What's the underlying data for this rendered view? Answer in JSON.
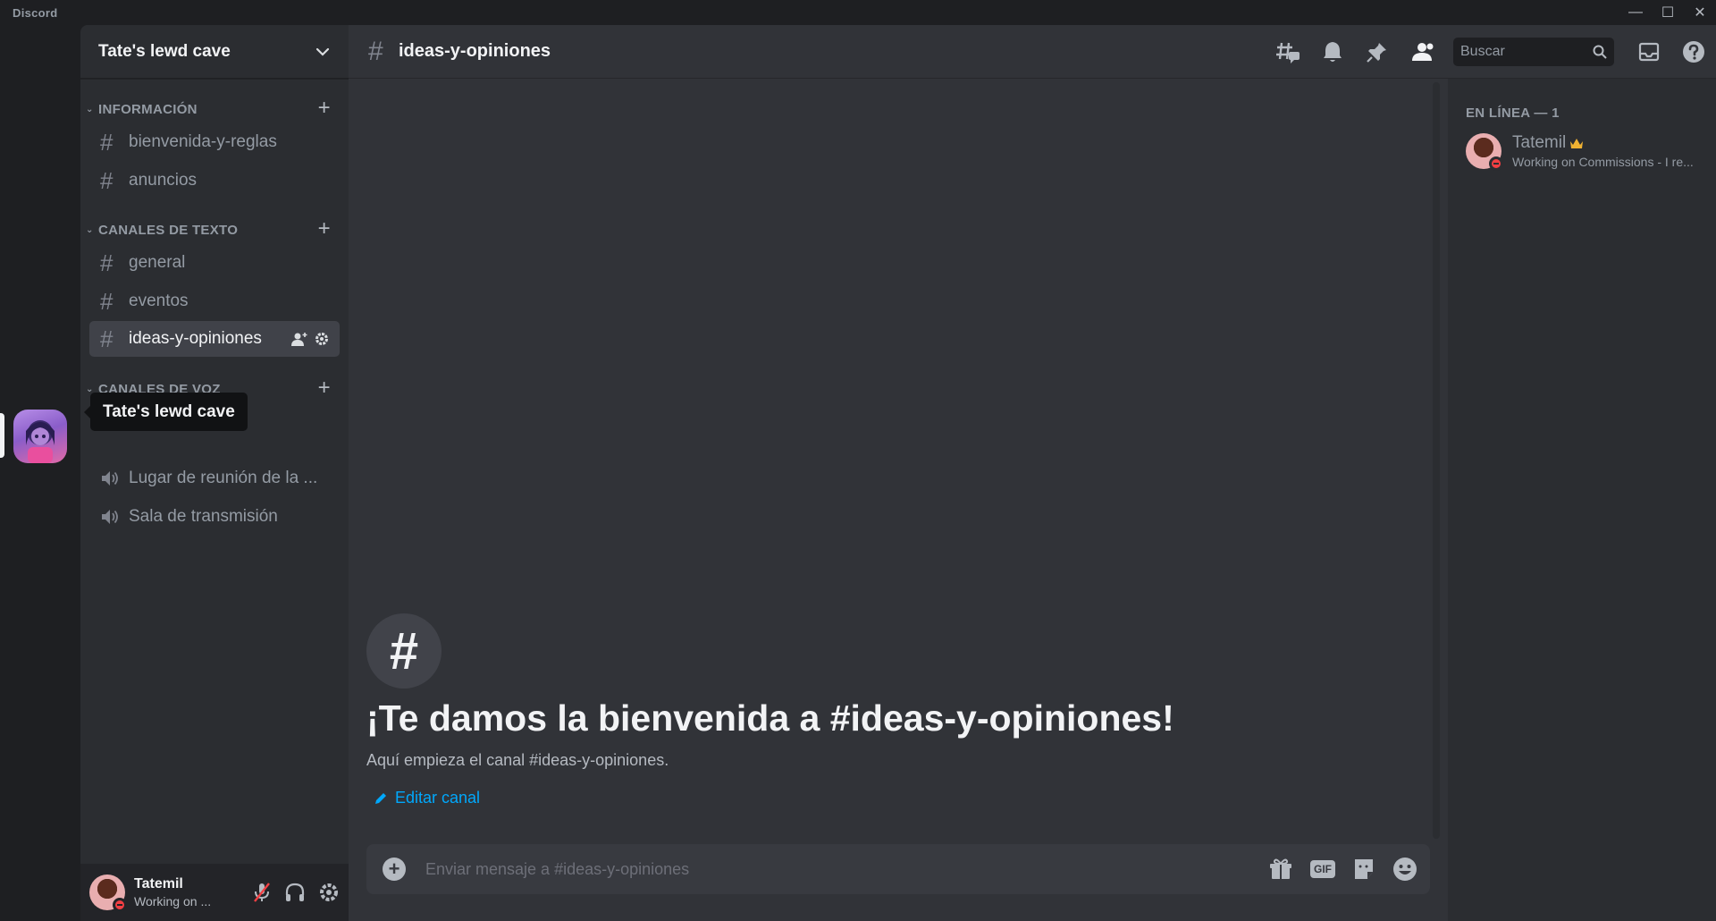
{
  "app": {
    "title": "Discord"
  },
  "server": {
    "name": "Tate's lewd cave",
    "tooltip": "Tate's lewd cave"
  },
  "categories": [
    {
      "name": "INFORMACIÓN"
    },
    {
      "name": "CANALES DE TEXTO"
    },
    {
      "name": "CANALES DE VOZ"
    }
  ],
  "channels": {
    "info": [
      "bienvenida-y-reglas",
      "anuncios"
    ],
    "text": [
      "general",
      "eventos",
      "ideas-y-opiniones"
    ],
    "voice": [
      "Lugar de reunión de la ...",
      "Sala de transmisión"
    ]
  },
  "current_channel": {
    "name": "ideas-y-opiniones"
  },
  "search": {
    "placeholder": "Buscar"
  },
  "welcome": {
    "title": "¡Te damos la bienvenida a #ideas-y-opiniones!",
    "subtitle": "Aquí empieza el canal #ideas-y-opiniones.",
    "edit_label": "Editar canal"
  },
  "composer": {
    "placeholder": "Enviar mensaje a #ideas-y-opiniones",
    "gif_label": "GIF"
  },
  "user": {
    "name": "Tatemil",
    "status": "Working on ..."
  },
  "members": {
    "category": "EN LÍNEA — 1",
    "list": [
      {
        "name": "Tatemil",
        "status": "Working on Commissions - I re..."
      }
    ]
  },
  "colors": {
    "accent_link": "#00a8fc",
    "dnd_status": "#f23f43",
    "owner_crown": "#f0b232"
  }
}
